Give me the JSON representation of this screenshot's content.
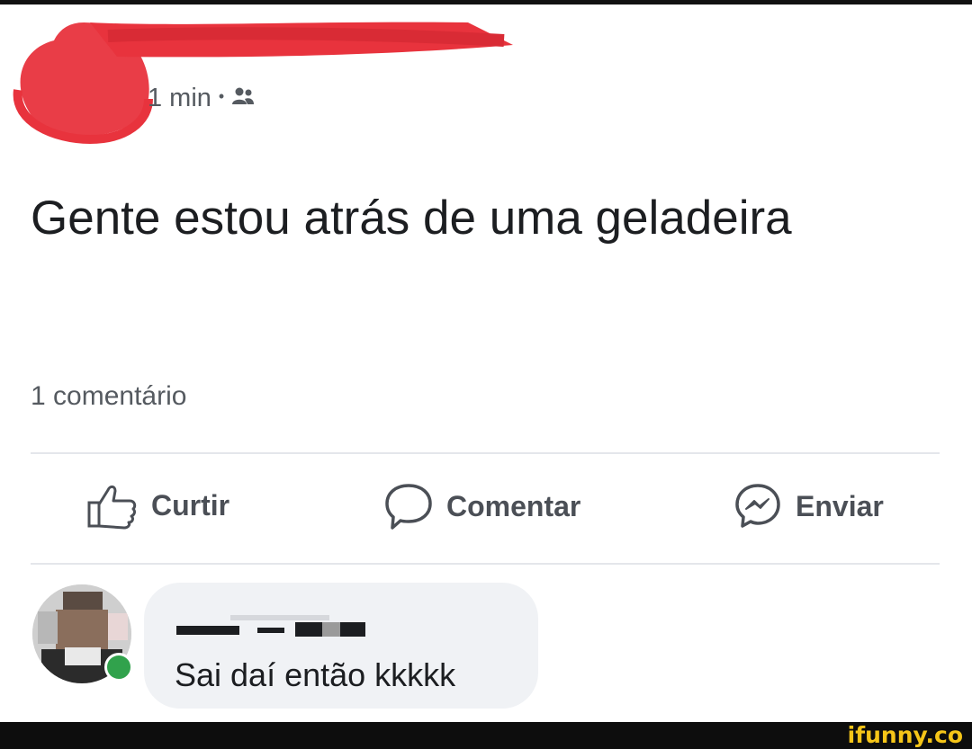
{
  "post": {
    "time": "1 min",
    "separator": "•",
    "audience_icon": "friends-icon",
    "text": "Gente estou atrás de uma geladeira",
    "comment_count": "1 comentário"
  },
  "actions": {
    "like_label": "Curtir",
    "comment_label": "Comentar",
    "send_label": "Enviar"
  },
  "comment": {
    "text": "Sai daí então kkkkk",
    "online_color": "#31a24c"
  },
  "watermark": {
    "text": "ifunny.co"
  },
  "colors": {
    "redaction": "#e8333d",
    "text_primary": "#1c1e21",
    "text_secondary": "#555a60"
  }
}
